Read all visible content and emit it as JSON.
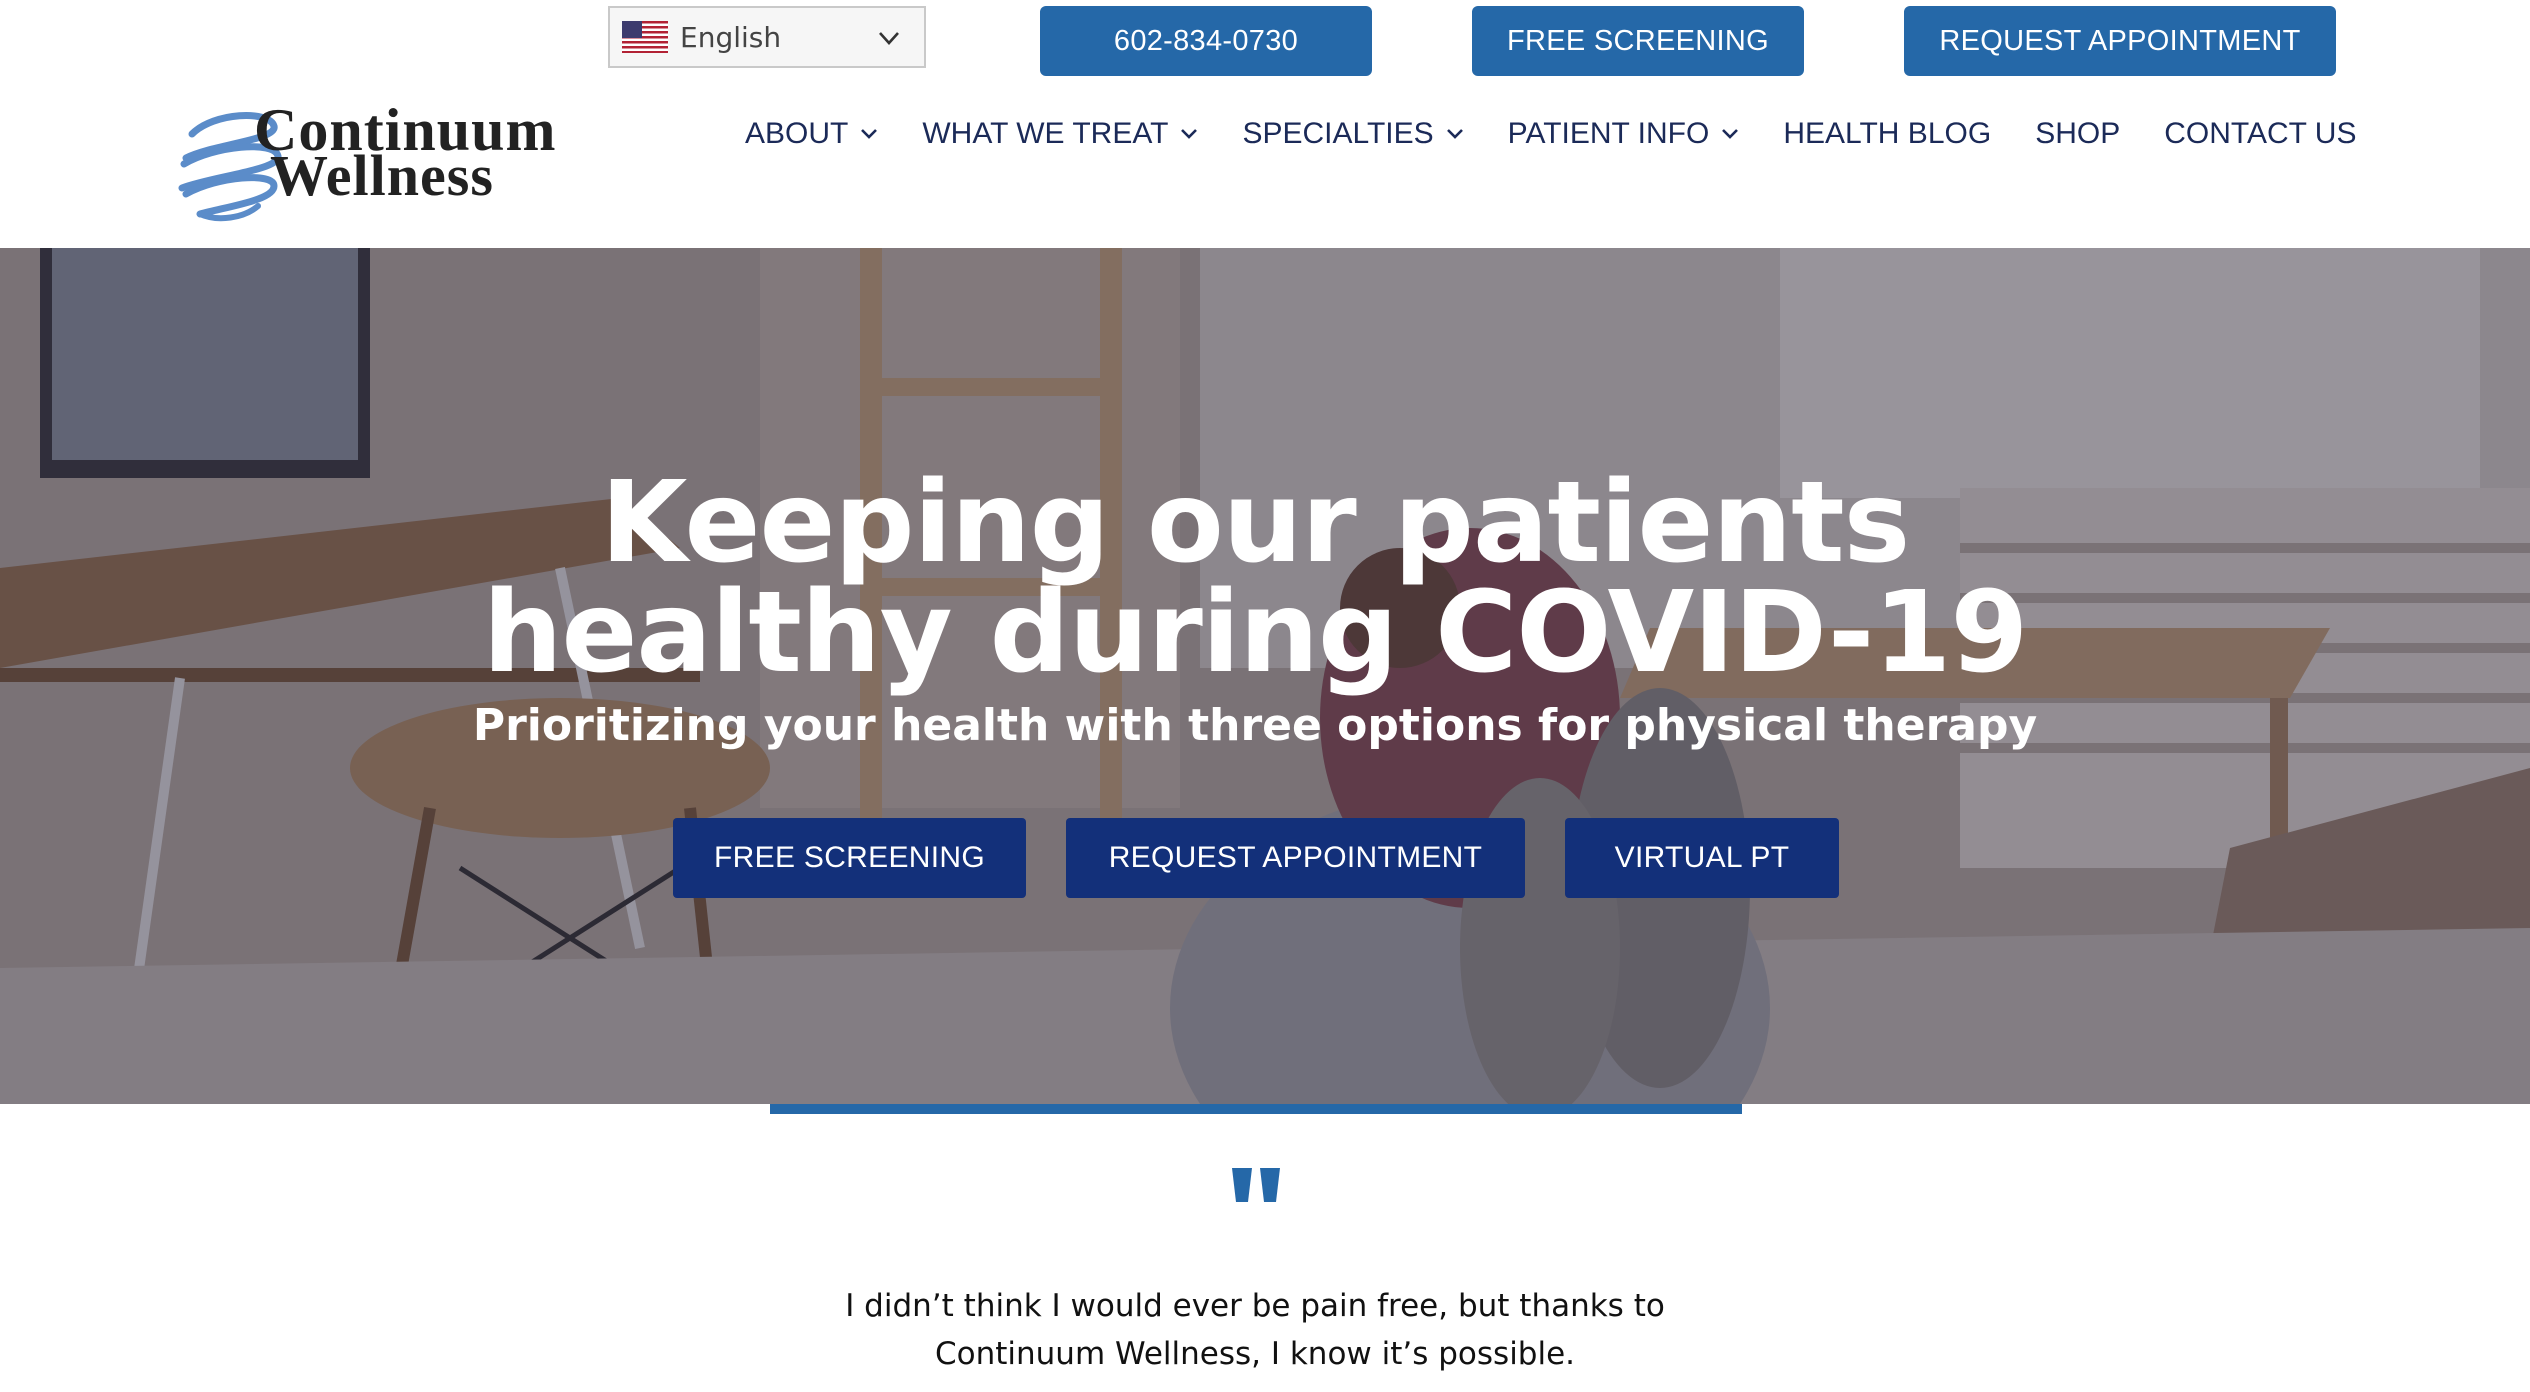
{
  "header": {
    "language": {
      "selected": "English",
      "flag_icon": "us-flag-icon"
    },
    "phone_button": "602-834-0730",
    "free_screening_button": "FREE SCREENING",
    "request_appointment_button": "REQUEST APPOINTMENT",
    "accent_color": "#2568a8"
  },
  "logo": {
    "line1": "Continuum",
    "line2": "Wellness"
  },
  "nav": {
    "items": [
      {
        "label": "ABOUT",
        "has_dropdown": true
      },
      {
        "label": "WHAT WE TREAT",
        "has_dropdown": true
      },
      {
        "label": "SPECIALTIES",
        "has_dropdown": true
      },
      {
        "label": "PATIENT INFO",
        "has_dropdown": true
      },
      {
        "label": "HEALTH BLOG",
        "has_dropdown": false
      },
      {
        "label": "SHOP",
        "has_dropdown": false
      },
      {
        "label": "CONTACT US",
        "has_dropdown": false
      }
    ],
    "text_color": "#1b2a58"
  },
  "hero": {
    "title_line1": "Keeping our patients",
    "title_line2": "healthy during COVID-19",
    "subtitle": "Prioritizing your health with three options for physical therapy",
    "buttons": [
      "FREE SCREENING",
      "REQUEST APPOINTMENT",
      "VIRTUAL PT"
    ],
    "button_color": "#13307a"
  },
  "testimonial": {
    "quote_icon": "quote-icon",
    "line1": "I didn’t think I would ever be pain free, but thanks to",
    "line2": "Continuum Wellness, I know it’s possible."
  }
}
